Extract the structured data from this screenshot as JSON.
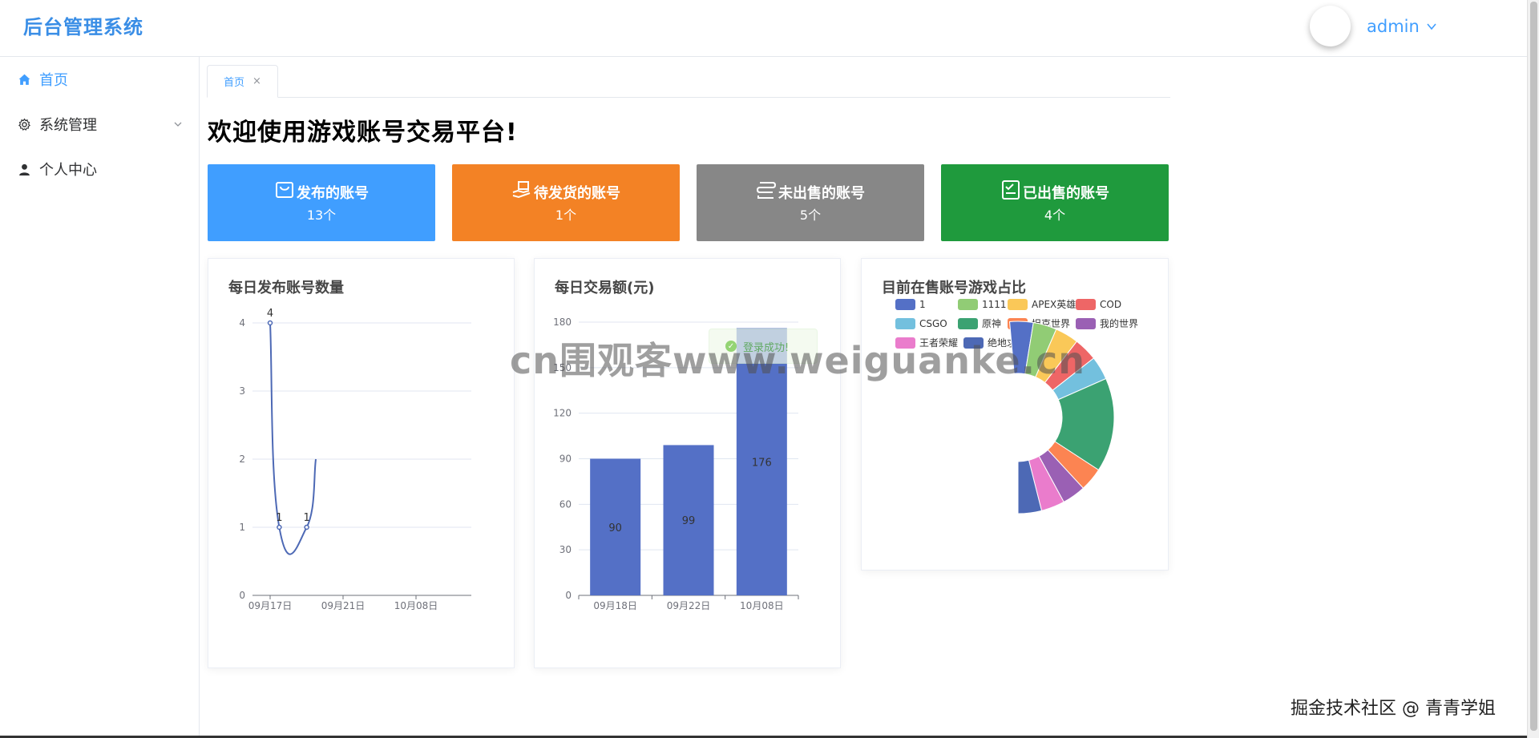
{
  "app": {
    "title": "后台管理系统"
  },
  "user": {
    "name": "admin"
  },
  "sidebar": {
    "items": [
      {
        "label": "首页",
        "icon": "home-icon",
        "active": true
      },
      {
        "label": "系统管理",
        "icon": "gear-icon",
        "active": false,
        "has_submenu": true
      },
      {
        "label": "个人中心",
        "icon": "user-icon",
        "active": false
      }
    ]
  },
  "tabs": [
    {
      "label": "首页",
      "closable": true
    }
  ],
  "welcome": "欢迎使用游戏账号交易平台!",
  "stats": [
    {
      "label": "发布的账号",
      "value": "13个",
      "color": "#409eff",
      "icon": "bag-icon"
    },
    {
      "label": "待发货的账号",
      "value": "1个",
      "color": "#f38225",
      "icon": "hand-box-icon"
    },
    {
      "label": "未出售的账号",
      "value": "5个",
      "color": "#878787",
      "icon": "list-icon"
    },
    {
      "label": "已出售的账号",
      "value": "4个",
      "color": "#1f9a3d",
      "icon": "checklist-icon"
    }
  ],
  "toast": {
    "message": "登录成功!"
  },
  "watermark": "cn围观客www.weiguanke.cn",
  "footer_watermark": "掘金技术社区 @ 青青学姐",
  "chart_data": [
    {
      "type": "line",
      "title": "每日发布账号数量",
      "x": [
        "09月17日",
        "09月21日",
        "10月08日"
      ],
      "points": [
        {
          "x": "09月17日",
          "y": 4
        },
        {
          "x": "09月18日",
          "y": 1
        },
        {
          "x": "09月21日",
          "y": 1
        },
        {
          "x": "09月22日",
          "y": 2
        }
      ],
      "point_labels": [
        "4",
        "1",
        "1"
      ],
      "ylim": [
        0,
        4
      ],
      "yticks": [
        0,
        1,
        2,
        3,
        4
      ],
      "color": "#4d69b5",
      "grid": true
    },
    {
      "type": "bar",
      "title": "每日交易额(元)",
      "categories": [
        "09月18日",
        "09月22日",
        "10月08日"
      ],
      "values": [
        90,
        99,
        176
      ],
      "ylim": [
        0,
        180
      ],
      "yticks": [
        0,
        30,
        60,
        90,
        120,
        150,
        180
      ],
      "color": "#5470c6",
      "grid": true
    },
    {
      "type": "pie",
      "title": "目前在售账号游戏占比",
      "legend": [
        "1",
        "1111",
        "APEX英雄",
        "COD",
        "CSGO",
        "原神",
        "坦克世界",
        "我的世界",
        "王者荣耀",
        "绝地求生"
      ],
      "colors": [
        "#5470c6",
        "#91cc75",
        "#fac858",
        "#ee6666",
        "#73c0de",
        "#3ba272",
        "#fc8452",
        "#9a60b4",
        "#ea7ccc",
        "#4d69b5"
      ],
      "values": [
        1,
        1,
        1,
        1,
        1,
        4,
        1,
        1,
        1,
        1
      ],
      "legend_position": "top-left"
    }
  ]
}
